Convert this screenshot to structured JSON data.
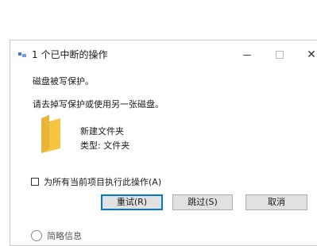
{
  "window": {
    "title": "1 个已中断的操作",
    "minimize_symbol": "—",
    "close_symbol": "✕"
  },
  "messages": {
    "line1": "磁盘被写保护。",
    "line2": "请去掉写保护或使用另一张磁盘。"
  },
  "file": {
    "name": "新建文件夹",
    "type": "类型: 文件夹",
    "icon": "folder-icon"
  },
  "apply_all": {
    "label": "为所有当前项目执行此操作(A)",
    "checked": false
  },
  "buttons": {
    "retry": "重试(R)",
    "skip": "跳过(S)",
    "cancel": "取消"
  },
  "details": {
    "label": "简略信息"
  },
  "colors": {
    "accent": "#0078d7",
    "folder": "#f5c542"
  }
}
